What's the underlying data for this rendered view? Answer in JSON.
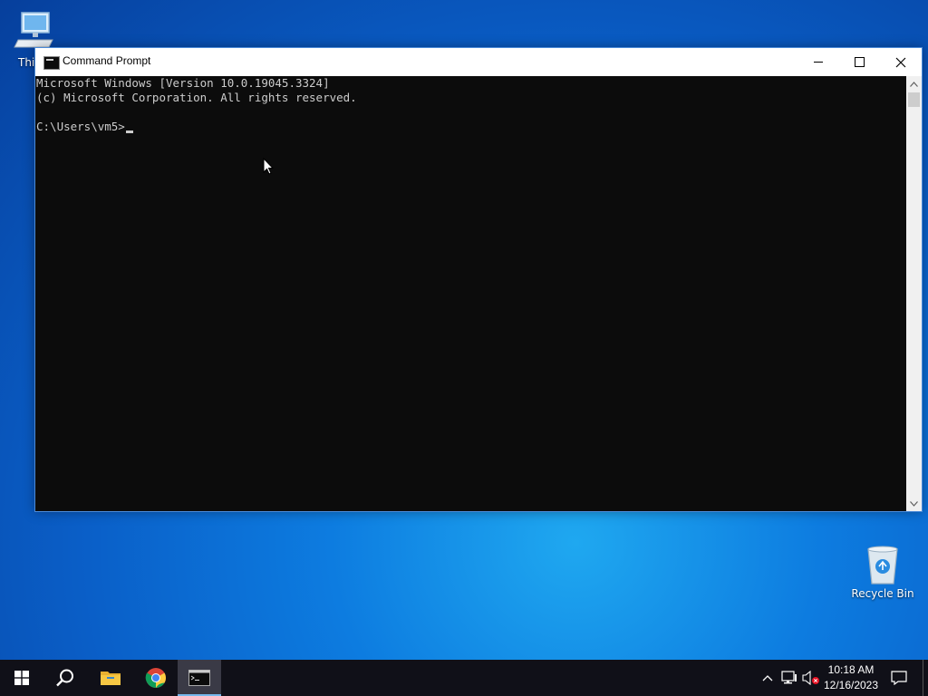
{
  "desktop": {
    "icons": [
      {
        "label": "This PC",
        "visible_label": "This"
      },
      {
        "label": "Recycle Bin"
      }
    ]
  },
  "window": {
    "title": "Command Prompt",
    "buttons": {
      "minimize": "minimize-icon",
      "maximize": "maximize-icon",
      "close": "close-icon"
    }
  },
  "console": {
    "lines": [
      "Microsoft Windows [Version 10.0.19045.3324]",
      "(c) Microsoft Corporation. All rights reserved.",
      "",
      "C:\\Users\\vm5>"
    ],
    "colors": {
      "background": "#0c0c0c",
      "foreground": "#cccccc"
    }
  },
  "taskbar": {
    "apps": [
      "windows-start-icon",
      "search-icon",
      "file-explorer-icon",
      "chrome-icon",
      "command-prompt-icon"
    ],
    "clock": {
      "time": "10:18 AM",
      "date": "12/16/2023"
    },
    "tray": [
      "chevron-up-icon",
      "network-icon",
      "volume-muted-icon",
      "notification-icon"
    ]
  }
}
